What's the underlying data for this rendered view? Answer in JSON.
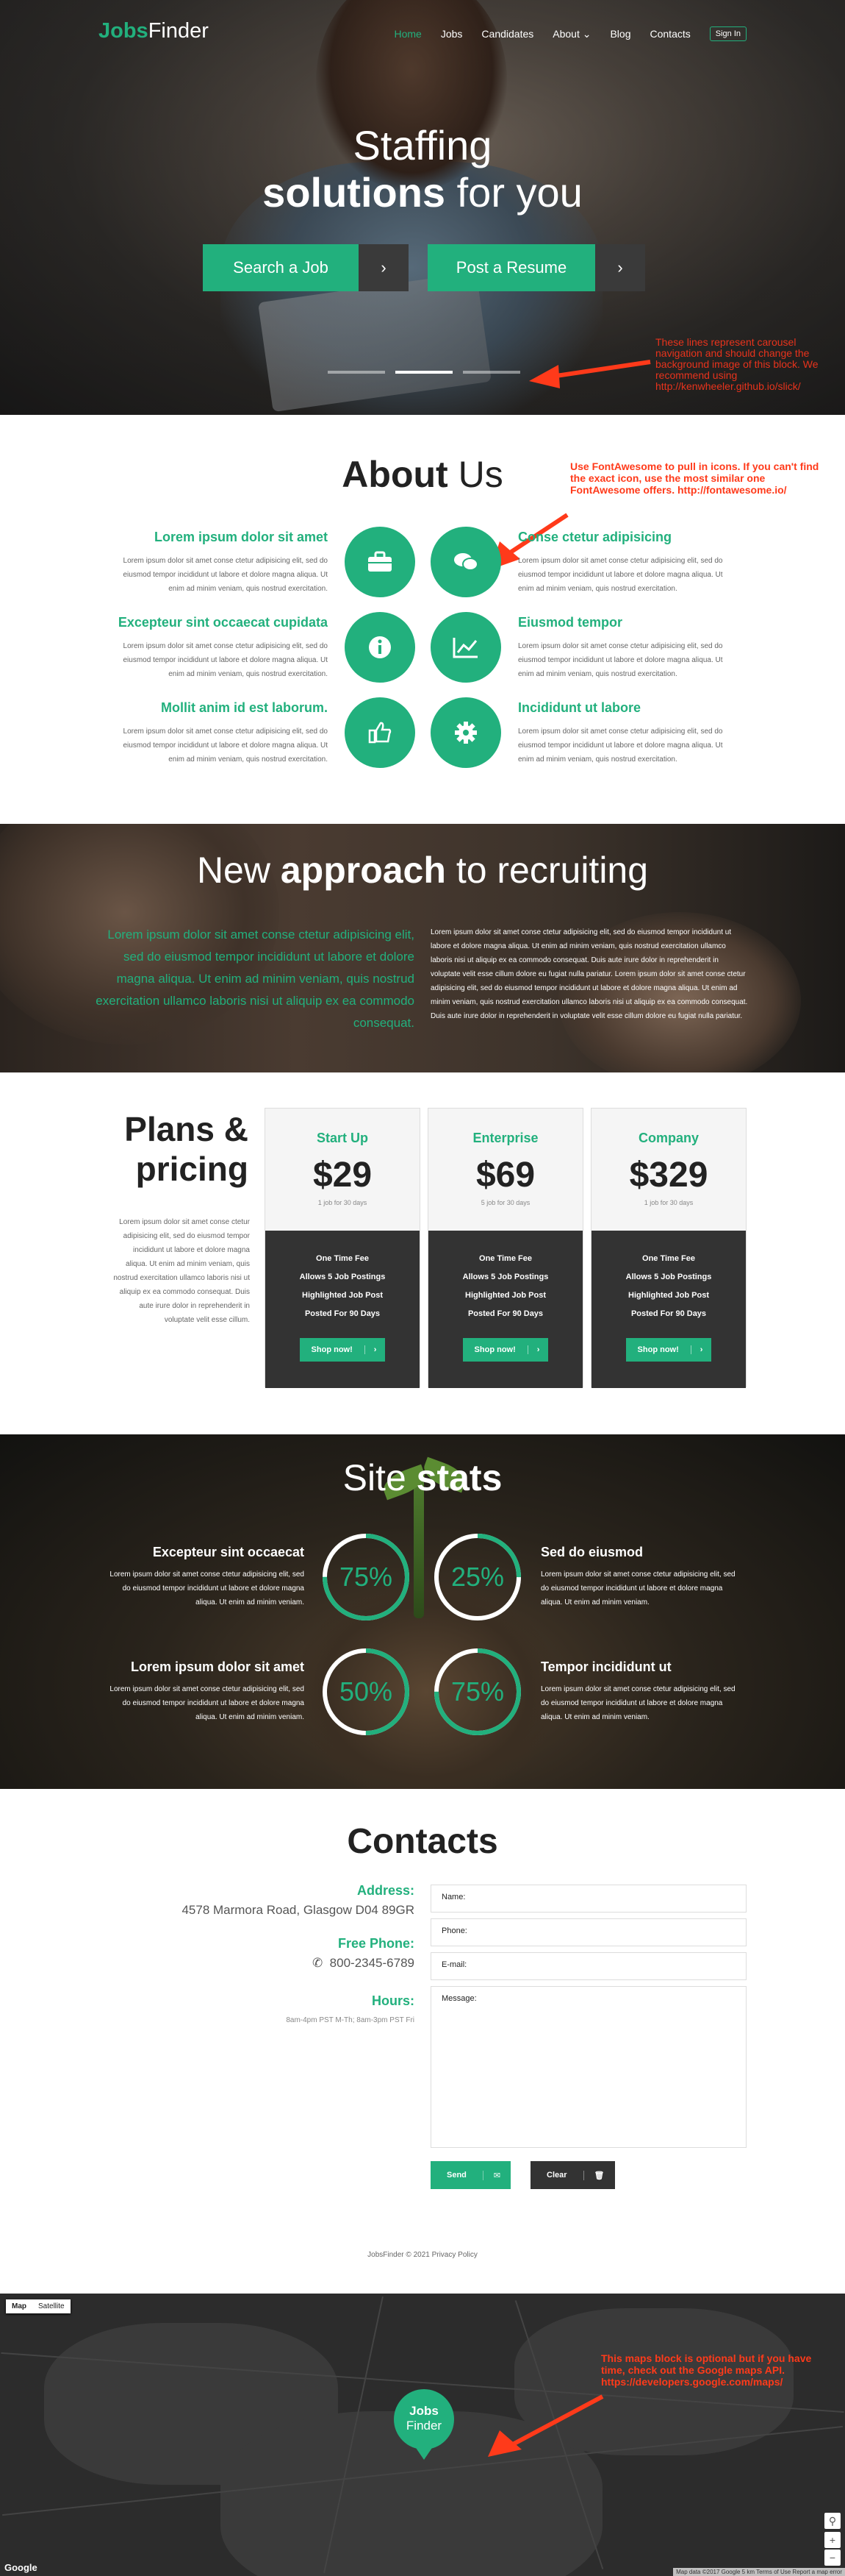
{
  "header": {
    "logo_bold": "Jobs",
    "logo_light": "Finder",
    "nav": [
      "Home",
      "Jobs",
      "Candidates",
      "About",
      "Blog",
      "Contacts"
    ],
    "signin": "Sign In"
  },
  "hero": {
    "title_line1": "Staffing",
    "title_bold": "solutions",
    "title_rest": " for you",
    "btn_search": "Search a Job",
    "btn_post": "Post a Resume",
    "arrow": "›",
    "note": "These lines represent carousel navigation and should change the background image of this block. We recommend using http://kenwheeler.github.io/slick/"
  },
  "about": {
    "title_bold": "About",
    "title_light": " Us",
    "note": "Use FontAwesome to pull in icons. If you can't find the exact icon, use the most similar one FontAwesome offers. http://fontawesome.io/",
    "items": [
      {
        "title": "Lorem ipsum dolor sit amet",
        "text": "Lorem ipsum dolor sit amet conse ctetur adipisicing elit, sed do eiusmod tempor incididunt ut labore et dolore magna aliqua. Ut enim ad minim veniam, quis nostrud exercitation."
      },
      {
        "title": "Conse ctetur adipisicing",
        "text": "Lorem ipsum dolor sit amet conse ctetur adipisicing elit, sed do eiusmod tempor incididunt ut labore et dolore magna aliqua. Ut enim ad minim veniam, quis nostrud exercitation."
      },
      {
        "title": "Excepteur sint occaecat cupidata",
        "text": "Lorem ipsum dolor sit amet conse ctetur adipisicing elit, sed do eiusmod tempor incididunt ut labore et dolore magna aliqua. Ut enim ad minim veniam, quis nostrud exercitation."
      },
      {
        "title": "Eiusmod tempor",
        "text": "Lorem ipsum dolor sit amet conse ctetur adipisicing elit, sed do eiusmod tempor incididunt ut labore et dolore magna aliqua. Ut enim ad minim veniam, quis nostrud exercitation."
      },
      {
        "title": "Mollit anim id est laborum.",
        "text": "Lorem ipsum dolor sit amet conse ctetur adipisicing elit, sed do eiusmod tempor incididunt ut labore et dolore magna aliqua. Ut enim ad minim veniam, quis nostrud exercitation."
      },
      {
        "title": "Incididunt ut labore",
        "text": "Lorem ipsum dolor sit amet conse ctetur adipisicing elit, sed do eiusmod tempor incididunt ut labore et dolore magna aliqua. Ut enim ad minim veniam, quis nostrud exercitation."
      }
    ],
    "icons": [
      "briefcase-icon",
      "comments-icon",
      "info-icon",
      "line-chart-icon",
      "thumbs-up-icon",
      "gear-icon"
    ]
  },
  "approach": {
    "title_light1": "New ",
    "title_bold": "approach",
    "title_light2": " to recruiting",
    "lead": "Lorem ipsum dolor sit amet conse ctetur adipisicing elit, sed do eiusmod tempor incididunt ut labore et dolore magna aliqua. Ut enim ad minim veniam, quis nostrud exercitation ullamco laboris nisi ut aliquip ex ea commodo consequat.",
    "body": "Lorem ipsum dolor sit amet conse ctetur adipisicing elit, sed do eiusmod tempor incididunt ut labore et dolore magna aliqua. Ut enim ad minim veniam, quis nostrud exercitation ullamco laboris nisi ut aliquip ex ea commodo consequat. Duis aute irure dolor in reprehenderit in voluptate velit esse cillum dolore eu fugiat nulla pariatur. Lorem ipsum dolor sit amet conse ctetur adipisicing elit, sed do eiusmod tempor incididunt ut labore et dolore magna aliqua. Ut enim ad minim veniam, quis nostrud exercitation ullamco laboris nisi ut aliquip ex ea commodo consequat. Duis aute irure dolor in reprehenderit in voluptate velit esse cillum dolore eu fugiat nulla pariatur."
  },
  "plans": {
    "title_bold": "Plans &",
    "title_light": "pricing",
    "desc": "Lorem ipsum dolor sit amet conse ctetur adipisicing elit, sed do eiusmod tempor incididunt ut labore et dolore magna aliqua. Ut enim ad minim veniam, quis nostrud exercitation ullamco laboris nisi ut aliquip ex ea commodo consequat. Duis aute irure dolor in reprehenderit in voluptate velit esse cillum.",
    "items": [
      {
        "name": "Start Up",
        "price": "$29",
        "per": "1 job for 30 days"
      },
      {
        "name": "Enterprise",
        "price": "$69",
        "per": "5 job for 30 days"
      },
      {
        "name": "Company",
        "price": "$329",
        "per": "1 job for 30 days"
      }
    ],
    "features": [
      "One Time Fee",
      "Allows 5 Job Postings",
      "Highlighted Job Post",
      "Posted For 90 Days"
    ],
    "shop": "Shop now!"
  },
  "stats": {
    "title_light": "Site ",
    "title_bold": "stats",
    "items": [
      {
        "title": "Excepteur sint occaecat",
        "text": "Lorem ipsum dolor sit amet conse ctetur adipisicing elit, sed do eiusmod tempor incididunt ut labore et dolore magna aliqua. Ut enim ad minim veniam.",
        "value": "75%",
        "fraction": 0.75
      },
      {
        "title": "Sed do eiusmod",
        "text": "Lorem ipsum dolor sit amet conse ctetur adipisicing elit, sed do eiusmod tempor incididunt ut labore et dolore magna aliqua. Ut enim ad minim veniam.",
        "value": "25%",
        "fraction": 0.25
      },
      {
        "title": "Lorem ipsum dolor sit amet",
        "text": "Lorem ipsum dolor sit amet conse ctetur adipisicing elit, sed do eiusmod tempor incididunt ut labore et dolore magna aliqua. Ut enim ad minim veniam.",
        "value": "50%",
        "fraction": 0.5
      },
      {
        "title": "Tempor incididunt ut",
        "text": "Lorem ipsum dolor sit amet conse ctetur adipisicing elit, sed do eiusmod tempor incididunt ut labore et dolore magna aliqua. Ut enim ad minim veniam.",
        "value": "75%",
        "fraction": 0.75
      }
    ]
  },
  "contacts": {
    "title": "Contacts",
    "address_label": "Address:",
    "address": "4578 Marmora Road, Glasgow D04 89GR",
    "phone_label": "Free Phone:",
    "phone": "800-2345-6789",
    "hours_label": "Hours:",
    "hours": "8am-4pm PST M-Th;   8am-3pm PST Fri",
    "form": {
      "name": "Name:",
      "phone": "Phone:",
      "email": "E-mail:",
      "message": "Message:"
    },
    "send": "Send",
    "clear": "Clear"
  },
  "footer": "JobsFinder © 2021 Privacy Policy",
  "map": {
    "toggle": [
      "Map",
      "Satellite"
    ],
    "pin_line1": "Jobs",
    "pin_line2": "Finder",
    "note": "This maps block is optional but if you have time, check out the Google maps API. https://developers.google.com/maps/",
    "google": "Google",
    "attribution": "Map data ©2017 Google  5 km  Terms of Use  Report a map error",
    "zoom_in": "+",
    "zoom_out": "−"
  },
  "colors": {
    "accent": "#22b07d",
    "dark": "#333333",
    "note": "#e8331c"
  }
}
